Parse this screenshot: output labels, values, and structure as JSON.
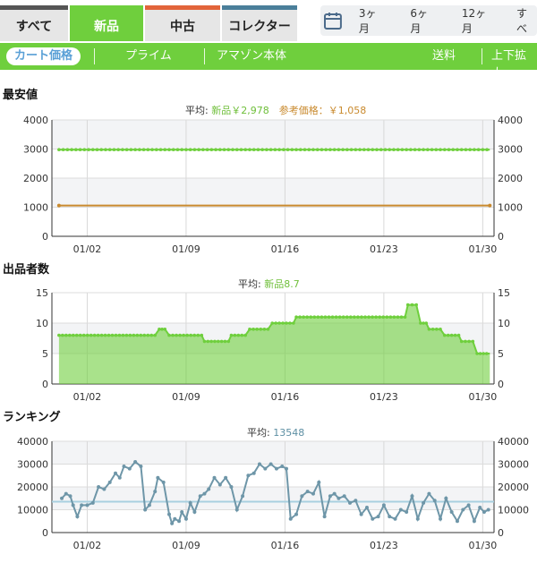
{
  "tabs": [
    {
      "label": "すべて",
      "active": false,
      "bar": "#555555"
    },
    {
      "label": "新品",
      "active": true,
      "bar": "#6fcf3d"
    },
    {
      "label": "中古",
      "active": false,
      "bar": "#e2643a"
    },
    {
      "label": "コレクター",
      "active": false,
      "bar": "#4a7f9a"
    }
  ],
  "range": {
    "icon": "calendar-icon",
    "options": [
      "3ヶ月",
      "6ヶ月",
      "12ヶ月",
      "すべ"
    ]
  },
  "filters": {
    "cart": "カート価格",
    "prime": "プライム",
    "amazon": "アマゾン本体",
    "shipping": "送料",
    "zoom": "上下拡大"
  },
  "colors": {
    "green": "#6fcf3d",
    "orange": "#c98a2e",
    "blue": "#6e96a8",
    "hline": "#a8d0e0"
  },
  "charts": {
    "price": {
      "title": "最安値",
      "avg_prefix": "平均: ",
      "avg_new": "新品￥2,978",
      "avg_ref_sep": "　参考価格：",
      "avg_ref": "￥1,058"
    },
    "sellers": {
      "title": "出品者数",
      "avg_prefix": "平均: ",
      "avg_new": "新品8.7"
    },
    "rank": {
      "title": "ランキング",
      "avg_prefix": "平均: ",
      "avg_val": "13548"
    }
  },
  "chart_data": [
    {
      "type": "line",
      "title": "最安値",
      "x_ticks": [
        "01/02",
        "01/09",
        "01/16",
        "01/23",
        "01/30"
      ],
      "ylim": [
        0,
        4000
      ],
      "y_ticks": [
        0,
        1000,
        2000,
        3000,
        4000
      ],
      "series": [
        {
          "name": "新品",
          "color": "#6fcf3d",
          "x": [
            -1,
            29.5
          ],
          "values": [
            2978,
            2978
          ]
        },
        {
          "name": "参考価格",
          "color": "#c98a2e",
          "x": [
            -1,
            29.5
          ],
          "values": [
            1058,
            1058
          ]
        }
      ]
    },
    {
      "type": "area",
      "title": "出品者数",
      "x_ticks": [
        "01/02",
        "01/09",
        "01/16",
        "01/23",
        "01/30"
      ],
      "ylim": [
        0,
        15
      ],
      "y_ticks": [
        0,
        5,
        10,
        15
      ],
      "series": [
        {
          "name": "新品",
          "color": "#6fcf3d",
          "x": [
            -1,
            5.8,
            6.1,
            6.5,
            6.8,
            9.1,
            9.3,
            11.0,
            11.2,
            12.2,
            12.5,
            13.8,
            14.1,
            15.6,
            15.8,
            23.5,
            23.7,
            24.3,
            24.6,
            25.0,
            25.2,
            26.0,
            26.3,
            27.3,
            27.5,
            28.3,
            28.6,
            29.5
          ],
          "values": [
            8,
            8,
            9,
            9,
            8,
            8,
            7,
            7,
            8,
            8,
            9,
            9,
            10,
            10,
            11,
            11,
            13,
            13,
            10,
            10,
            9,
            9,
            8,
            8,
            7,
            7,
            5,
            5
          ]
        }
      ]
    },
    {
      "type": "line",
      "title": "ランキング",
      "x_ticks": [
        "01/02",
        "01/09",
        "01/16",
        "01/23",
        "01/30"
      ],
      "ylim": [
        0,
        40000
      ],
      "y_ticks": [
        0,
        10000,
        20000,
        30000,
        40000
      ],
      "average": 13548,
      "series": [
        {
          "name": "ランキング",
          "color": "#6e96a8",
          "x": [
            -0.8,
            -0.5,
            -0.2,
            0.0,
            0.3,
            0.6,
            1.0,
            1.4,
            1.8,
            2.2,
            2.6,
            3.0,
            3.3,
            3.6,
            4.0,
            4.4,
            4.8,
            5.1,
            5.4,
            5.8,
            6.0,
            6.4,
            6.8,
            7.0,
            7.2,
            7.5,
            7.7,
            8.0,
            8.3,
            8.6,
            9.0,
            9.3,
            9.6,
            10.0,
            10.4,
            10.8,
            11.2,
            11.6,
            12.0,
            12.4,
            12.8,
            13.2,
            13.6,
            14.0,
            14.4,
            14.8,
            15.1,
            15.4,
            15.8,
            16.2,
            16.6,
            17.0,
            17.4,
            17.8,
            18.2,
            18.5,
            18.8,
            19.2,
            19.6,
            20.0,
            20.4,
            20.8,
            21.2,
            21.6,
            22.0,
            22.4,
            22.8,
            23.2,
            23.6,
            24.0,
            24.4,
            24.8,
            25.2,
            25.6,
            26.0,
            26.4,
            26.8,
            27.2,
            27.6,
            28.0,
            28.4,
            28.8,
            29.1,
            29.4
          ],
          "values": [
            15000,
            17000,
            16000,
            12000,
            7000,
            12000,
            12000,
            13000,
            20000,
            19000,
            22000,
            26000,
            24000,
            29000,
            28000,
            31000,
            29000,
            10000,
            12000,
            18000,
            24000,
            22000,
            8000,
            4000,
            6000,
            5000,
            9000,
            6000,
            13000,
            9000,
            16000,
            17000,
            19000,
            24000,
            21000,
            24000,
            20000,
            10000,
            16000,
            25000,
            26000,
            30000,
            28000,
            30000,
            28000,
            29000,
            28000,
            6000,
            8000,
            16000,
            18000,
            17000,
            22000,
            7000,
            16000,
            17000,
            15000,
            16000,
            13000,
            14000,
            8000,
            11000,
            6000,
            7000,
            12000,
            7000,
            6000,
            10000,
            9000,
            16000,
            6000,
            13000,
            17000,
            14000,
            6000,
            15000,
            9000,
            5000,
            10000,
            12000,
            5000,
            11000,
            9000,
            10000
          ]
        }
      ]
    }
  ]
}
